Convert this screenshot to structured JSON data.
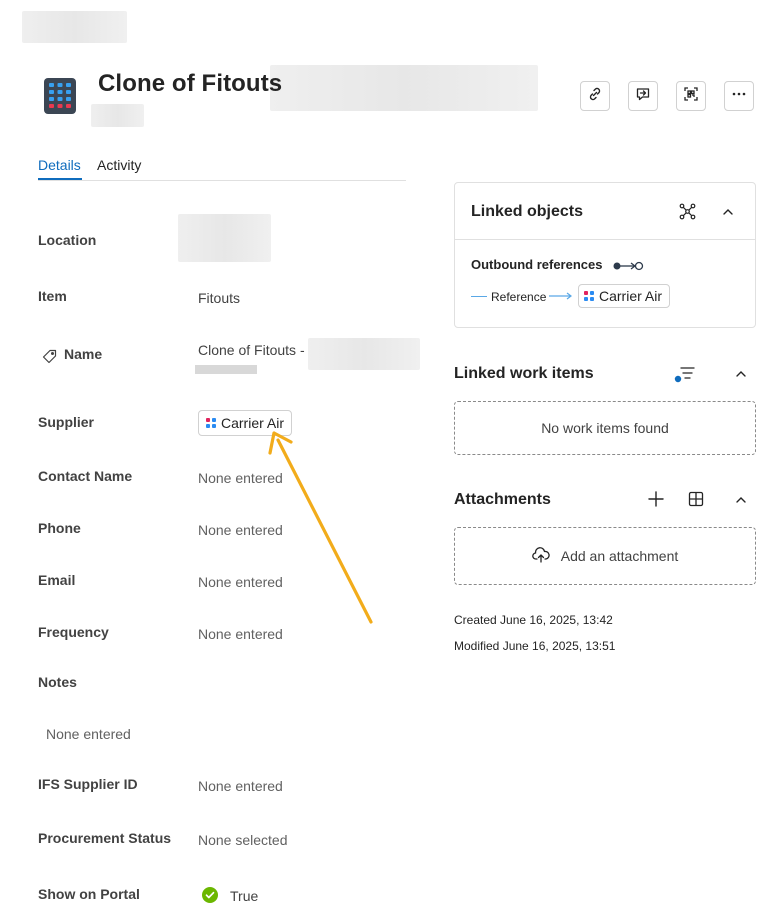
{
  "header": {
    "title": "Clone of Fitouts",
    "app_icon": "building-icon",
    "actions": [
      {
        "name": "copy-link-button",
        "icon": "link-icon"
      },
      {
        "name": "send-to-chat-button",
        "icon": "chat-arrow-icon"
      },
      {
        "name": "scan-qr-button",
        "icon": "scan-icon"
      },
      {
        "name": "more-options-button",
        "icon": "more-icon"
      }
    ]
  },
  "tabs": [
    {
      "label": "Details",
      "active": true
    },
    {
      "label": "Activity",
      "active": false
    }
  ],
  "fields": {
    "location": {
      "label": "Location"
    },
    "item": {
      "label": "Item",
      "value": "Fitouts"
    },
    "name": {
      "label": "Name",
      "value": "Clone of Fitouts -",
      "icon": "tag-icon"
    },
    "supplier": {
      "label": "Supplier",
      "value": "Carrier Air"
    },
    "contact_name": {
      "label": "Contact Name",
      "value": "None entered"
    },
    "phone": {
      "label": "Phone",
      "value": "None entered"
    },
    "email": {
      "label": "Email",
      "value": "None entered"
    },
    "frequency": {
      "label": "Frequency",
      "value": "None entered"
    },
    "notes": {
      "label": "Notes",
      "value": "None entered"
    },
    "ifs_supplier_id": {
      "label": "IFS Supplier ID",
      "value": "None entered"
    },
    "procurement_status": {
      "label": "Procurement Status",
      "value": "None selected"
    },
    "show_on_portal": {
      "label": "Show on Portal",
      "value": "True",
      "icon": "check-circle-icon"
    }
  },
  "linked_objects": {
    "title": "Linked objects",
    "outbound_label": "Outbound references",
    "reference_label": "Reference",
    "reference_target": "Carrier Air"
  },
  "linked_work_items": {
    "title": "Linked work items",
    "empty_text": "No work items found"
  },
  "attachments": {
    "title": "Attachments",
    "add_label": "Add an attachment"
  },
  "meta": {
    "created": "Created June 16, 2025, 13:42",
    "modified": "Modified June 16, 2025, 13:51"
  },
  "colors": {
    "accent": "#0f6cbd",
    "annotation_arrow": "#f2ac1b",
    "success": "#6bb700",
    "chip_red": "#e0245e",
    "chip_blue": "#2a8bf2"
  }
}
